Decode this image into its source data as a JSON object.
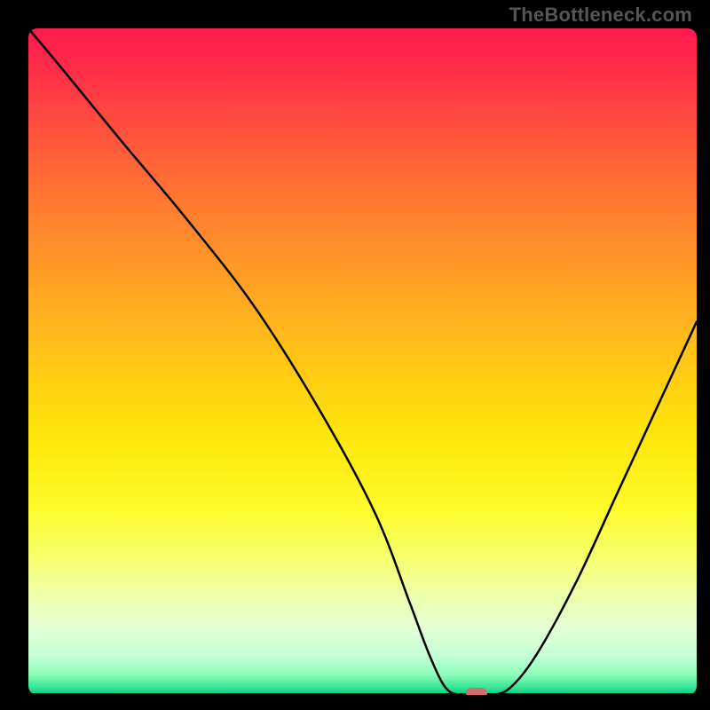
{
  "watermark": "TheBottleneck.com",
  "chart_data": {
    "type": "line",
    "title": "",
    "xlabel": "",
    "ylabel": "",
    "xlim": [
      0,
      100
    ],
    "ylim": [
      0,
      100
    ],
    "series": [
      {
        "name": "curve",
        "x": [
          0,
          5,
          14,
          24,
          34,
          44,
          52,
          57,
          60,
          62.5,
          65,
          69,
          72,
          76,
          82,
          88,
          94,
          100
        ],
        "values": [
          100,
          94,
          83,
          71,
          58,
          42,
          27,
          14,
          6,
          1,
          0,
          0,
          1,
          6,
          17,
          30,
          43,
          56
        ]
      }
    ],
    "baseline_y": 0,
    "marker": {
      "x": 67,
      "y": 0
    },
    "colors": {
      "curve": "#000000",
      "marker": "#d46d6d",
      "gradient_top": "#ff1a4d",
      "gradient_bottom": "#03c97a"
    }
  }
}
